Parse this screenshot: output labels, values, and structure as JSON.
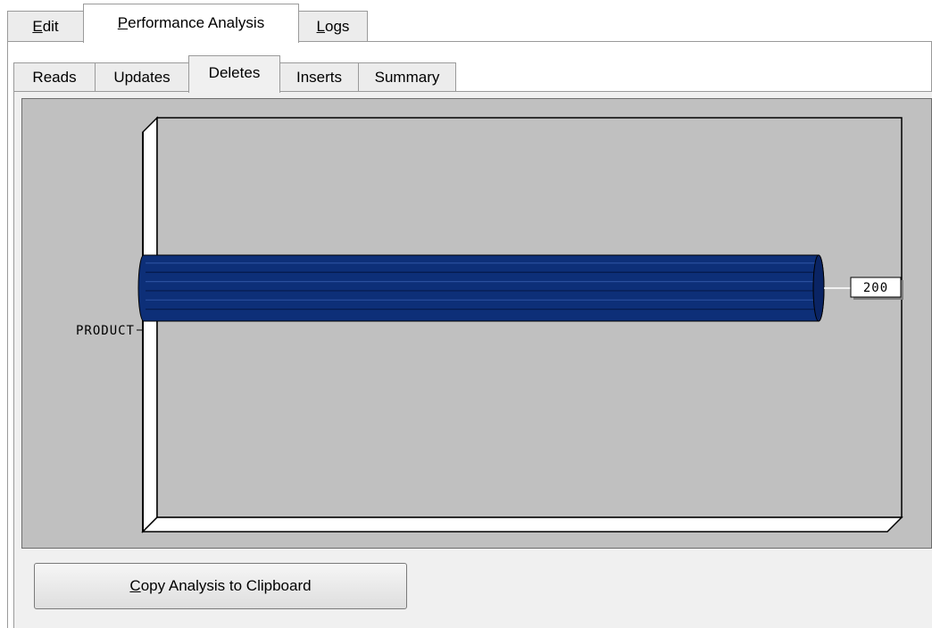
{
  "top_tabs": [
    {
      "label_prefix": "",
      "label_accel": "E",
      "label_rest": "dit",
      "active": false
    },
    {
      "label_prefix": "",
      "label_accel": "P",
      "label_rest": "erformance Analysis",
      "active": true
    },
    {
      "label_prefix": "",
      "label_accel": "L",
      "label_rest": "ogs",
      "active": false
    }
  ],
  "sub_tabs": [
    {
      "label": "Reads",
      "active": false
    },
    {
      "label": "Updates",
      "active": false
    },
    {
      "label": "Deletes",
      "active": true
    },
    {
      "label": "Inserts",
      "active": false
    },
    {
      "label": "Summary",
      "active": false
    }
  ],
  "chart_data": {
    "type": "bar",
    "orientation": "horizontal",
    "style": "3d-cylinder",
    "categories": [
      "PRODUCT"
    ],
    "values": [
      200
    ],
    "data_labels": [
      "200"
    ],
    "bar_color": "#0d2f78",
    "plot_background": "#c0c0c0",
    "title": "",
    "xlabel": "",
    "ylabel": ""
  },
  "copy_button": {
    "label_accel": "C",
    "label_rest": "opy Analysis to Clipboard"
  }
}
